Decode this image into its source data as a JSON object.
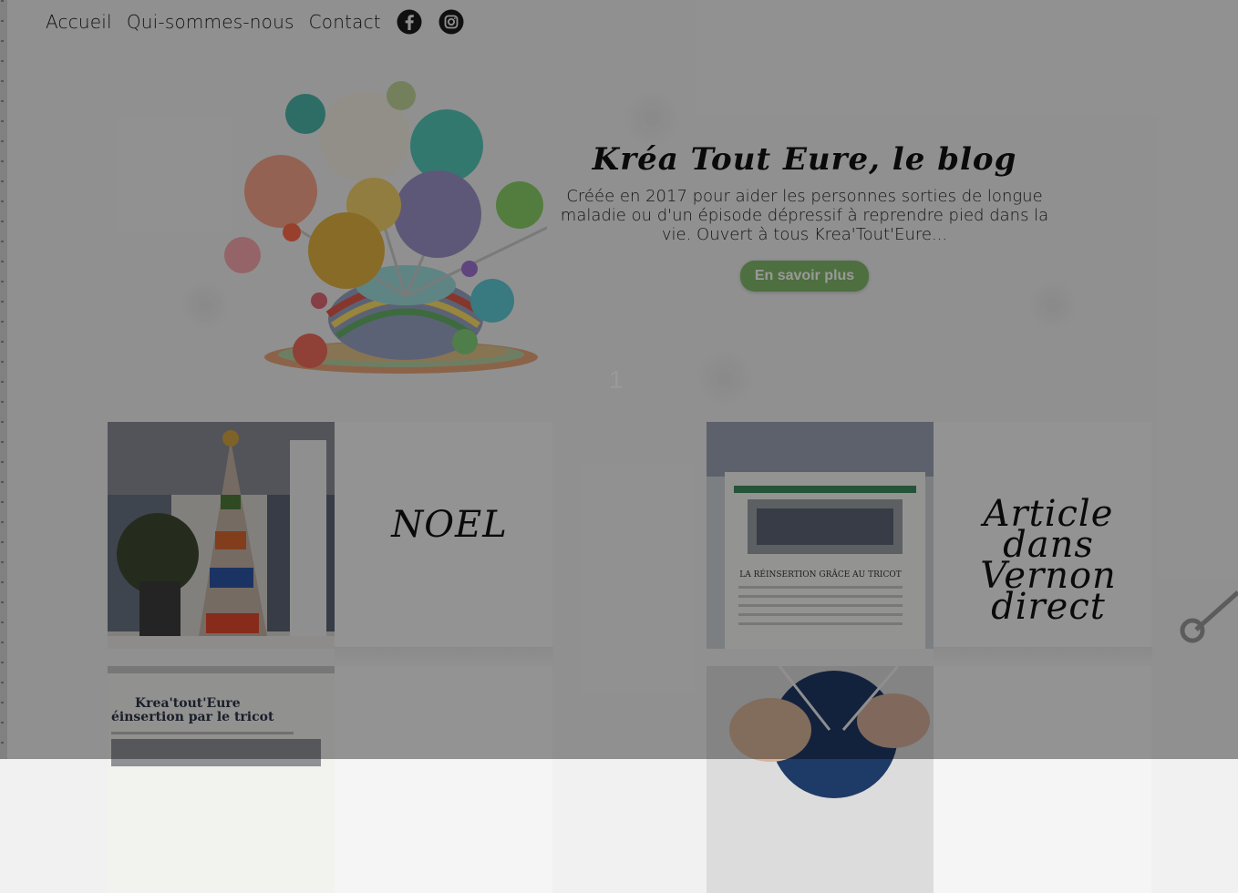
{
  "nav": {
    "items": [
      "Accueil",
      "Qui-sommes-nous",
      "Contact"
    ],
    "facebook_icon": "facebook-icon",
    "instagram_icon": "instagram-icon"
  },
  "hero": {
    "title": "Kréa Tout Eure, le blog",
    "description": "Créée en 2017 pour aider les personnes sorties de longue maladie ou d'un épisode dépressif à reprendre pied dans la vie. Ouvert à tous Krea'Tout'Eure...",
    "button_label": "En savoir plus",
    "slide_number": "1",
    "button_color": "#83b969"
  },
  "articles": [
    {
      "title": "NOEL",
      "thumb": "knitted-christmas-tree-photo"
    },
    {
      "title": "Article dans Vernon direct",
      "thumb": "newspaper-article-photo",
      "thumb_text": "LA RÉINSERTION GRÂCE AU TRICOT"
    },
    {
      "title": "",
      "thumb": "newspaper-clipping-photo",
      "thumb_text_1": "Krea'tout'Eure",
      "thumb_text_2": "éinsertion par le tricot"
    },
    {
      "title": "",
      "thumb": "knitting-hands-photo"
    }
  ],
  "overlay_color": "rgba(0,0,0,0.40)"
}
